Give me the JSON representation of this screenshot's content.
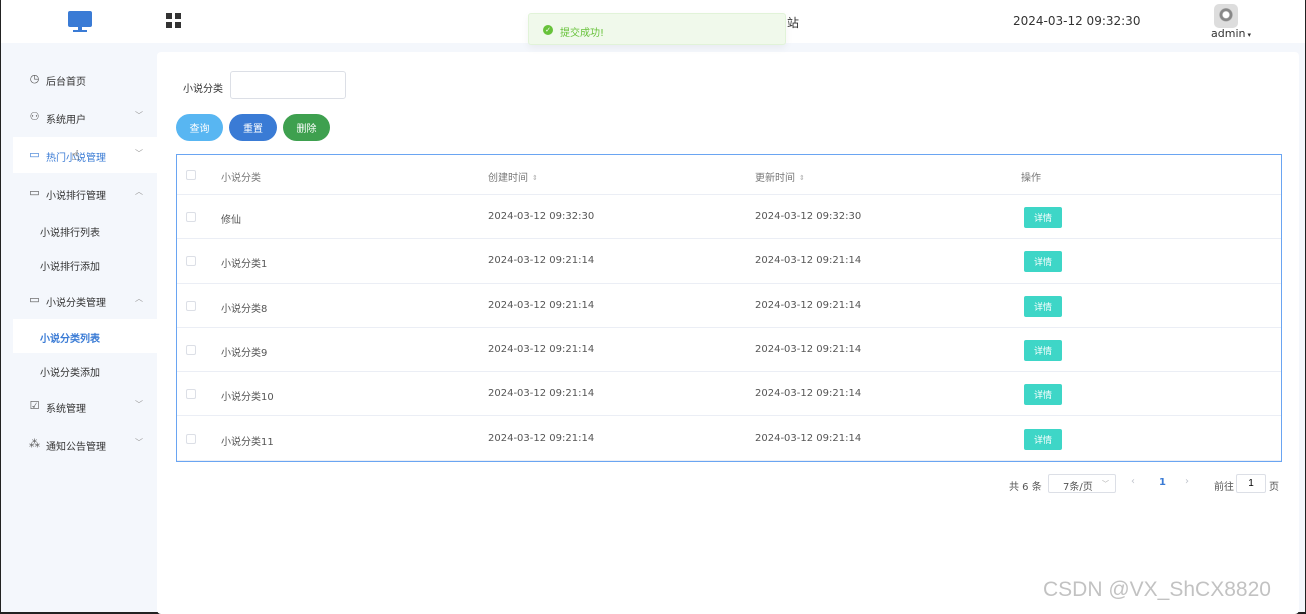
{
  "header": {
    "site_title_fragment": "站",
    "datetime": "2024-03-12 09:32:30",
    "user": "admin",
    "caret": "▾"
  },
  "toast": {
    "message": "提交成功!",
    "icon": "check-circle-icon",
    "color": "#67c23a"
  },
  "sidebar": {
    "items": [
      {
        "label": "后台首页",
        "icon": "◷",
        "arrow": ""
      },
      {
        "label": "系统用户",
        "icon": "⚇",
        "arrow": "﹀"
      },
      {
        "label": "热门小说管理",
        "icon": "▭",
        "arrow": "﹀"
      },
      {
        "label": "小说排行管理",
        "icon": "▭",
        "arrow": "︿"
      },
      {
        "label": "小说分类管理",
        "icon": "▭",
        "arrow": "︿"
      },
      {
        "label": "系统管理",
        "icon": "☑",
        "arrow": "﹀"
      },
      {
        "label": "通知公告管理",
        "icon": "⁂",
        "arrow": "﹀"
      }
    ],
    "sub_items": [
      {
        "label": "小说排行列表"
      },
      {
        "label": "小说排行添加"
      },
      {
        "label": "小说分类列表"
      },
      {
        "label": "小说分类添加"
      }
    ]
  },
  "search": {
    "label": "小说分类",
    "value": ""
  },
  "buttons": {
    "query": "查询",
    "reset": "重置",
    "delete": "删除"
  },
  "table": {
    "headers": {
      "category": "小说分类",
      "created": "创建时间",
      "updated": "更新时间",
      "actions": "操作"
    },
    "sort_icon": "⇕",
    "detail_label": "详情",
    "rows": [
      {
        "category": "修仙",
        "created": "2024-03-12 09:32:30",
        "updated": "2024-03-12 09:32:30"
      },
      {
        "category": "小说分类1",
        "created": "2024-03-12 09:21:14",
        "updated": "2024-03-12 09:21:14"
      },
      {
        "category": "小说分类8",
        "created": "2024-03-12 09:21:14",
        "updated": "2024-03-12 09:21:14"
      },
      {
        "category": "小说分类9",
        "created": "2024-03-12 09:21:14",
        "updated": "2024-03-12 09:21:14"
      },
      {
        "category": "小说分类10",
        "created": "2024-03-12 09:21:14",
        "updated": "2024-03-12 09:21:14"
      },
      {
        "category": "小说分类11",
        "created": "2024-03-12 09:21:14",
        "updated": "2024-03-12 09:21:14"
      }
    ]
  },
  "pagination": {
    "total": "共 6 条",
    "page_size": "7条/页",
    "prev": "‹",
    "current": "1",
    "next": "›",
    "goto_label": "前往",
    "goto_value": "1",
    "page_suffix": "页"
  },
  "watermark": "CSDN @VX_ShCX8820",
  "colors": {
    "accent": "#3a7bd5",
    "query": "#58b6f2",
    "delete": "#3ea04f",
    "detail": "#3ed6c7"
  }
}
